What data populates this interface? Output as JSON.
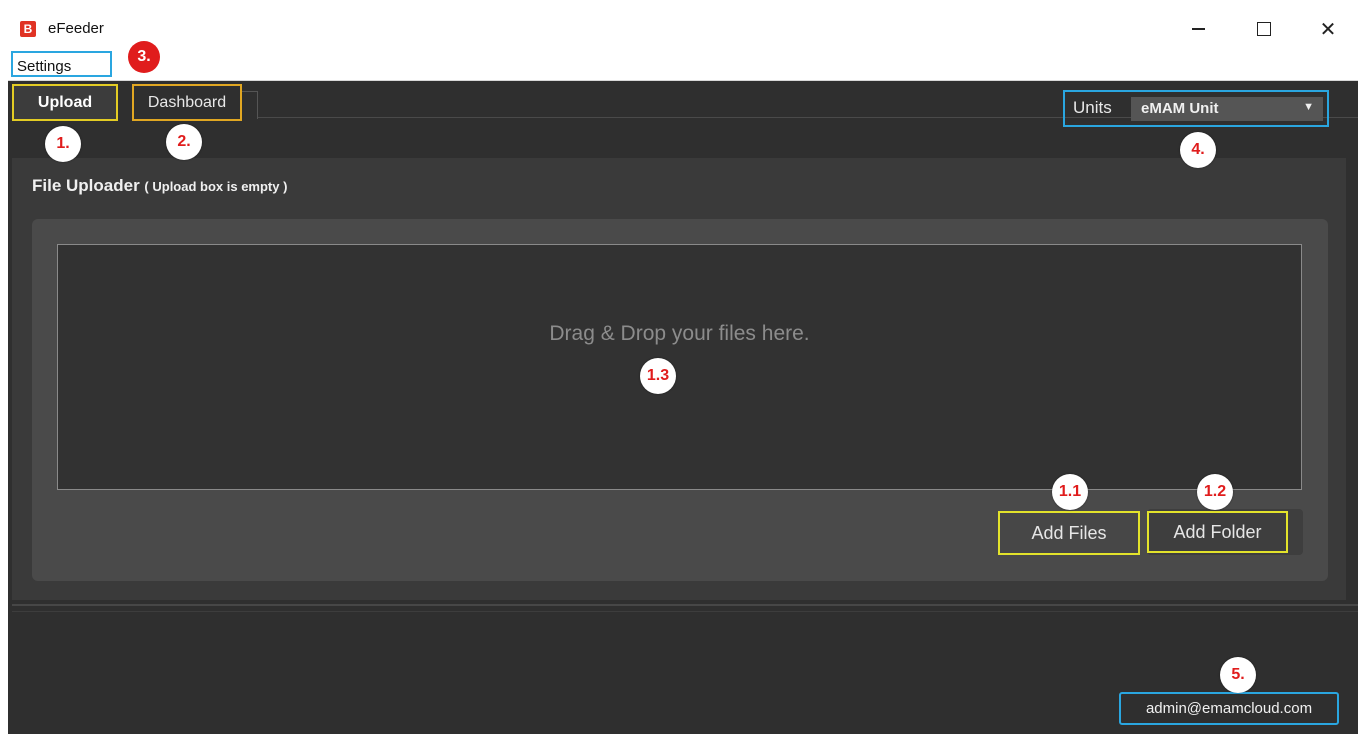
{
  "window": {
    "title": "eFeeder",
    "logo_glyph": "B",
    "controls": {
      "minimize": "minimize-icon",
      "maximize": "maximize-icon",
      "close": "✕"
    }
  },
  "menu": {
    "settings": "Settings"
  },
  "tabs": [
    {
      "label": "Upload",
      "selected": true
    },
    {
      "label": "Dashboard",
      "selected": false
    }
  ],
  "units": {
    "label": "Units",
    "selected": "eMAM Unit"
  },
  "file_uploader": {
    "title": "File Uploader",
    "status": "( Upload box is empty )",
    "drop_text": "Drag & Drop your files here.",
    "add_files": "Add Files",
    "add_folder": "Add Folder"
  },
  "footer": {
    "user": "admin@emamcloud.com"
  },
  "annotations": {
    "upload": "1.",
    "dashboard": "2.",
    "settings": "3.",
    "units": "4.",
    "user": "5.",
    "add_files": "1.1",
    "add_folder": "1.2",
    "drop_zone": "1.3"
  },
  "colors": {
    "highlight_yellow": "#e3cc24",
    "highlight_orange": "#e1a722",
    "highlight_blue": "#2aa6e0",
    "marker_red": "#e01c1c",
    "app_logo": "#e03324",
    "background": "#2f2f2f"
  }
}
